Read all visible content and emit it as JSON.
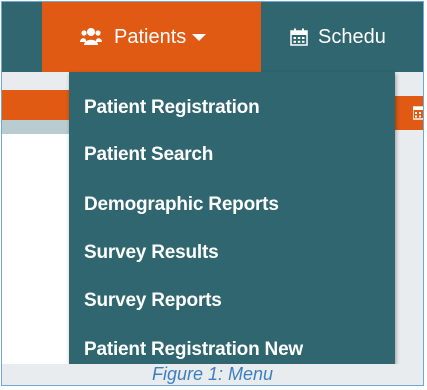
{
  "nav": {
    "patients_label": "Patients",
    "schedule_label": "Schedu"
  },
  "dropdown": {
    "items": [
      "Patient Registration",
      "Patient Search",
      "Demographic Reports",
      "Survey Results",
      "Survey Reports",
      "Patient Registration New"
    ]
  },
  "caption": "Figure 1: Menu",
  "colors": {
    "nav_bg": "#2f6670",
    "active_tab": "#e05a13",
    "dropdown_bg": "#2f6670",
    "caption_text": "#3c7fc0",
    "frame_border": "#6fa8d6"
  },
  "icons": {
    "patients": "users-icon",
    "schedule": "calendar-icon"
  }
}
